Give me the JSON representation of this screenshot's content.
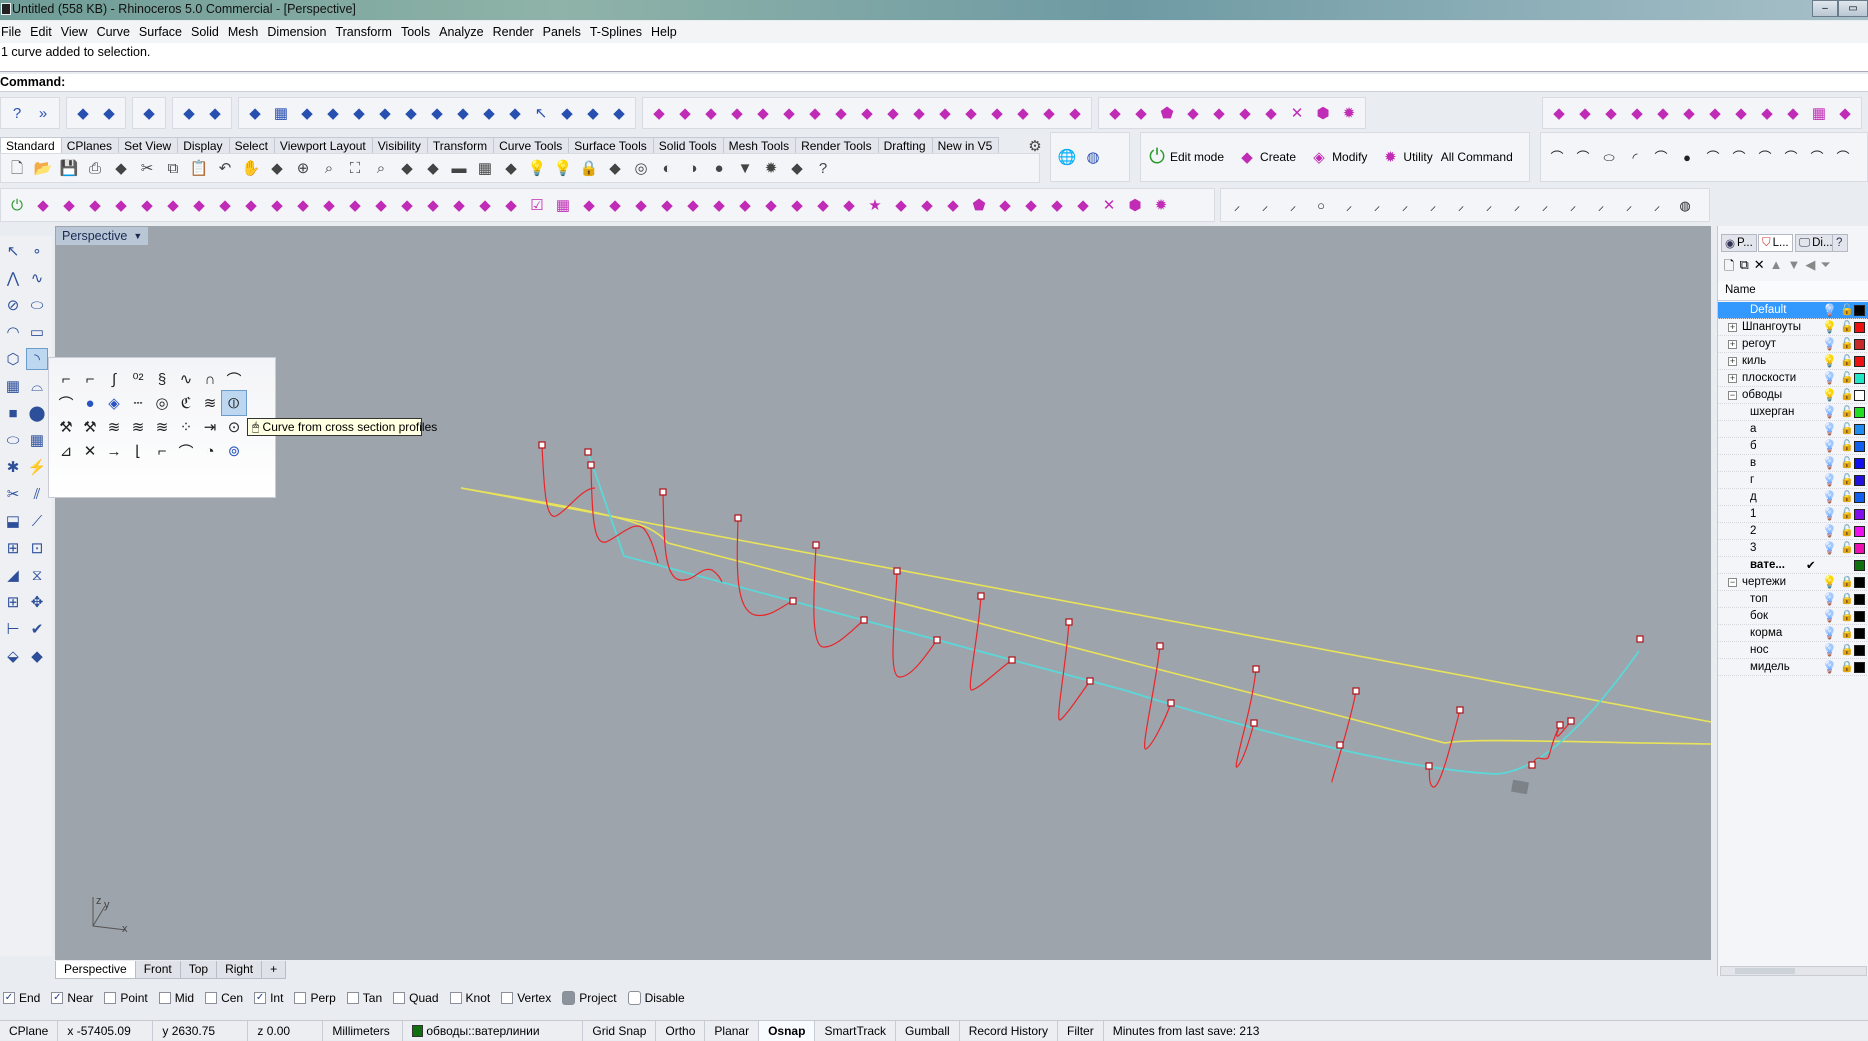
{
  "window": {
    "title": "Untitled (558 KB) - Rhinoceros 5.0 Commercial - [Perspective]",
    "buttons": [
      "–",
      "▭",
      "✕"
    ]
  },
  "menu": [
    "File",
    "Edit",
    "View",
    "Curve",
    "Surface",
    "Solid",
    "Mesh",
    "Dimension",
    "Transform",
    "Tools",
    "Analyze",
    "Render",
    "Panels",
    "T-Splines",
    "Help"
  ],
  "command": {
    "history": "1 curve added to selection.",
    "prompt": "Command:"
  },
  "toolbar_tabs": [
    "Standard",
    "CPlanes",
    "Set View",
    "Display",
    "Select",
    "Viewport Layout",
    "Visibility",
    "Transform",
    "Curve Tools",
    "Surface Tools",
    "Solid Tools",
    "Mesh Tools",
    "Render Tools",
    "Drafting",
    "New in V5"
  ],
  "tsplines": {
    "edit_mode": "Edit mode",
    "create": "Create",
    "modify": "Modify",
    "utility": "Utility",
    "all_command": "All Command"
  },
  "toolbar_icons": {
    "row1": [
      [
        "help",
        "more"
      ],
      [
        "layer-tools",
        "match-properties"
      ],
      [
        "cplane"
      ],
      [
        "section",
        "contour"
      ],
      [
        "show-points",
        "grid",
        "set-x",
        "set-y",
        "set-z",
        "flow",
        "hide",
        "show",
        "bend",
        "split",
        "trim",
        "select",
        "explode",
        "rebuild",
        "sweep"
      ],
      [
        "edge-loft",
        "rail",
        "ribbon",
        "network",
        "patch",
        "pyramid",
        "box",
        "surface",
        "extrude",
        "blend",
        "offset",
        "array",
        "pipe",
        "heightfield",
        "unroll",
        "plane",
        "twist"
      ],
      [
        "gumball",
        "transform",
        "pentagon",
        "stack",
        "fillet",
        "planar",
        "corner",
        "x-split",
        "solid",
        "gear"
      ],
      [
        "rotate",
        "flow",
        "arch",
        "sweep",
        "offset",
        "extrude",
        "wall",
        "cube",
        "bend",
        "mesh",
        "grid",
        "box"
      ]
    ],
    "standard": [
      "new",
      "open",
      "save",
      "print",
      "import",
      "cut",
      "copy",
      "paste",
      "undo",
      "pan",
      "rotate-view",
      "zoom-in",
      "zoom-window",
      "zoom-extents",
      "zoom-selected",
      "undo-view",
      "four-view",
      "car",
      "grid",
      "circle-snap",
      "light",
      "bulb",
      "lock",
      "render",
      "color-wheel",
      "shade",
      "ghost",
      "sphere",
      "spotlight",
      "gear",
      "dimension",
      "help"
    ],
    "row3": [
      "power",
      "extrude",
      "mesh-box",
      "bend",
      "stack",
      "cube",
      "twist",
      "split",
      "patch",
      "loft",
      "bevel",
      "arch",
      "offset",
      "fold",
      "corner",
      "wall",
      "column",
      "panel",
      "ribbon",
      "stack",
      "check",
      "grid",
      "rotate",
      "matrix",
      "fire",
      "fire2",
      "bridge",
      "mirror",
      "stack2",
      "points",
      "rail",
      "brush",
      "spread",
      "star",
      "flip",
      "gumball",
      "starburst",
      "pentagon",
      "stack3",
      "fillet",
      "planar",
      "corner",
      "x-split",
      "solid",
      "gear"
    ],
    "curve_points": [
      "line",
      "polyline",
      "line2",
      "circle",
      "axis",
      "segment",
      "angle",
      "v-line",
      "point-pair",
      "dots",
      "short",
      "short2",
      "vertical",
      "diagonal",
      "arc",
      "polygon",
      "sphere-grid"
    ],
    "right_row2": [
      "curve1",
      "curve2",
      "ellipse",
      "arc",
      "points",
      "sphere",
      "loop",
      "corner",
      "corner2",
      "vee",
      "angle",
      "spiral"
    ],
    "mesh_spheres": [
      "mesh-sphere",
      "mesh-ball"
    ]
  },
  "viewport": {
    "label": "Perspective",
    "curve_colors": {
      "profiles": "#e8262a",
      "sheer": "#e8e35a",
      "keel_line": "#5ad8d8"
    },
    "axis": {
      "y": "y",
      "z": "z",
      "x": "x"
    }
  },
  "left_toolbar_icons": [
    "select",
    "point",
    "polyline",
    "curve",
    "circle",
    "ellipse",
    "arc",
    "rectangle",
    "polygon",
    "curve-flyout",
    "surface",
    "extrude-surface",
    "box",
    "sphere",
    "cylinder",
    "mesh-patch",
    "explode",
    "boolean",
    "trim",
    "split",
    "fillet",
    "blend",
    "drape",
    "join",
    "offset",
    "rebuild",
    "array",
    "gumball",
    "dimension",
    "check",
    "paint",
    "light"
  ],
  "flyout": {
    "icons": [
      "control-point-curve",
      "interpolate",
      "curve-handle",
      "degree-2",
      "sketch",
      "conic",
      "arc-section",
      "blend-curve",
      "curve-through-points",
      "helix",
      "curve-on-surface",
      "dotted-line",
      "spiral",
      "catenary",
      "tween",
      "cross-section-profiles",
      "fit",
      "fit-nurbs",
      "fit-text",
      "dec",
      "fair",
      "points-ring",
      "extend",
      "point-edit",
      "insert-point",
      "remove-point",
      "move-point",
      "handle",
      "corner",
      "offset",
      "circle-shadow",
      "cylinder-ring"
    ],
    "tooltip": "Curve from cross section profiles"
  },
  "panel": {
    "tabs": [
      {
        "icon": "properties-icon",
        "label": "P..."
      },
      {
        "icon": "layers-icon",
        "label": "L..."
      },
      {
        "icon": "display-icon",
        "label": "Di..."
      },
      {
        "icon": "help-icon",
        "label": ""
      }
    ],
    "tools": [
      "new-layer",
      "new-sublayer",
      "delete",
      "move-up",
      "move-down",
      "move-left",
      "filter"
    ],
    "header": "Name",
    "layers": [
      {
        "name": "Default",
        "level": 0,
        "expander": "",
        "bulb": "#5aa0e0",
        "locked": false,
        "color": "#000000",
        "current": true
      },
      {
        "name": "Шпангоуты",
        "level": 0,
        "expander": "+",
        "bulb": "#f2ea70",
        "locked": false,
        "color": "#ee1111"
      },
      {
        "name": "регоут",
        "level": 0,
        "expander": "+",
        "bulb": "#5aa0e0",
        "locked": false,
        "color": "#c82a2a"
      },
      {
        "name": "киль",
        "level": 0,
        "expander": "+",
        "bulb": "#f2ea70",
        "locked": false,
        "color": "#ee1111"
      },
      {
        "name": "плоскости",
        "level": 0,
        "expander": "+",
        "bulb": "#5aa0e0",
        "locked": false,
        "color": "#22e6c8"
      },
      {
        "name": "обводы",
        "level": 0,
        "expander": "−",
        "bulb": "#f2ea70",
        "locked": false,
        "color": "#ffffff"
      },
      {
        "name": "шхерган",
        "level": 1,
        "expander": "",
        "bulb": "#5aa0e0",
        "locked": false,
        "color": "#22dd22"
      },
      {
        "name": "а",
        "level": 1,
        "expander": "",
        "bulb": "#5aa0e0",
        "locked": false,
        "color": "#1e8cf0"
      },
      {
        "name": "б",
        "level": 1,
        "expander": "",
        "bulb": "#5aa0e0",
        "locked": false,
        "color": "#1460ee"
      },
      {
        "name": "в",
        "level": 1,
        "expander": "",
        "bulb": "#5aa0e0",
        "locked": false,
        "color": "#1010ee"
      },
      {
        "name": "г",
        "level": 1,
        "expander": "",
        "bulb": "#5aa0e0",
        "locked": false,
        "color": "#2210dd"
      },
      {
        "name": "д",
        "level": 1,
        "expander": "",
        "bulb": "#5aa0e0",
        "locked": false,
        "color": "#1460ee"
      },
      {
        "name": "1",
        "level": 1,
        "expander": "",
        "bulb": "#5aa0e0",
        "locked": false,
        "color": "#8010ee"
      },
      {
        "name": "2",
        "level": 1,
        "expander": "",
        "bulb": "#5aa0e0",
        "locked": false,
        "color": "#ee10ee"
      },
      {
        "name": "3",
        "level": 1,
        "expander": "",
        "bulb": "#5aa0e0",
        "locked": false,
        "color": "#ee10b0"
      },
      {
        "name": "вате...",
        "level": 1,
        "expander": "",
        "bulb": "",
        "locked": null,
        "color": "#107010",
        "active": "✔"
      },
      {
        "name": "чертежи",
        "level": 0,
        "expander": "−",
        "bulb": "#f2ea70",
        "locked": true,
        "color": "#000000"
      },
      {
        "name": "топ",
        "level": 1,
        "expander": "",
        "bulb": "#5aa0e0",
        "locked": true,
        "color": "#000000"
      },
      {
        "name": "бок",
        "level": 1,
        "expander": "",
        "bulb": "#5aa0e0",
        "locked": true,
        "color": "#000000"
      },
      {
        "name": "корма",
        "level": 1,
        "expander": "",
        "bulb": "#5aa0e0",
        "locked": true,
        "color": "#000000"
      },
      {
        "name": "нос",
        "level": 1,
        "expander": "",
        "bulb": "#5aa0e0",
        "locked": true,
        "color": "#000000"
      },
      {
        "name": "мидель",
        "level": 1,
        "expander": "",
        "bulb": "#5aa0e0",
        "locked": true,
        "color": "#000000"
      }
    ]
  },
  "viewport_tabs": [
    "Perspective",
    "Front",
    "Top",
    "Right",
    "+"
  ],
  "osnaps": [
    {
      "label": "End",
      "checked": true
    },
    {
      "label": "Near",
      "checked": true
    },
    {
      "label": "Point",
      "checked": false
    },
    {
      "label": "Mid",
      "checked": false
    },
    {
      "label": "Cen",
      "checked": false
    },
    {
      "label": "Int",
      "checked": true
    },
    {
      "label": "Perp",
      "checked": false
    },
    {
      "label": "Tan",
      "checked": false
    },
    {
      "label": "Quad",
      "checked": false
    },
    {
      "label": "Knot",
      "checked": false
    },
    {
      "label": "Vertex",
      "checked": false
    },
    {
      "label": "Project",
      "checked": true,
      "toggle": true
    },
    {
      "label": "Disable",
      "checked": false,
      "toggle": true
    }
  ],
  "status": {
    "cplane": "CPlane",
    "x": "x -57405.09",
    "y": "y 2630.75",
    "z": "z 0.00",
    "units": "Millimeters",
    "layer": "обводы::ватерлинии",
    "layer_color": "#107010",
    "toggles": [
      {
        "label": "Grid Snap",
        "on": false
      },
      {
        "label": "Ortho",
        "on": false
      },
      {
        "label": "Planar",
        "on": false
      },
      {
        "label": "Osnap",
        "on": true
      },
      {
        "label": "SmartTrack",
        "on": false
      },
      {
        "label": "Gumball",
        "on": false
      },
      {
        "label": "Record History",
        "on": false
      },
      {
        "label": "Filter",
        "on": false
      }
    ],
    "save_info": "Minutes from last save: 213"
  }
}
